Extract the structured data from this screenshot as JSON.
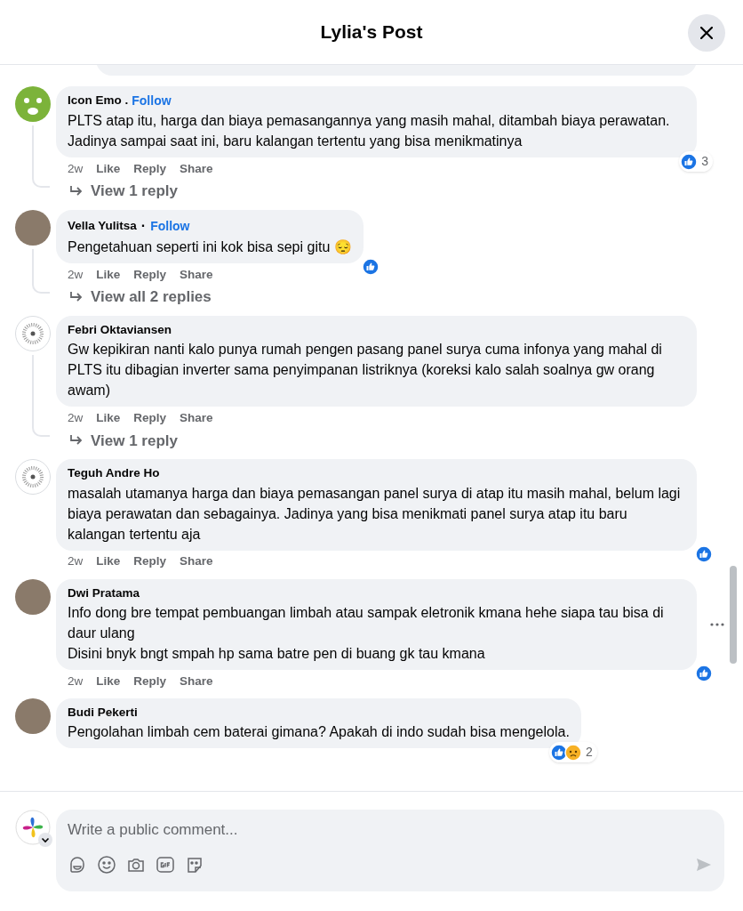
{
  "header": {
    "title": "Lylia's Post"
  },
  "comments": [
    {
      "name": "Icon Emo .",
      "follow": "Follow",
      "avatar": {
        "kind": "face"
      },
      "text": "PLTS atap itu, harga dan biaya pemasangannya yang masih mahal, ditambah biaya perawatan. Jadinya sampai saat ini, baru kalangan tertentu yang bisa menikmatinya",
      "time": "2w",
      "actions": [
        "Like",
        "Reply",
        "Share"
      ],
      "reactions": [
        {
          "kind": "like"
        }
      ],
      "reaction_count": "3",
      "replies": "View 1 reply"
    },
    {
      "name": "Vella Yulitsa",
      "separator": "·",
      "follow": "Follow",
      "avatar": {
        "kind": "photo"
      },
      "text": "Pengetahuan seperti ini kok bisa sepi gitu 😔",
      "time": "2w",
      "actions": [
        "Like",
        "Reply",
        "Share"
      ],
      "reactions": [
        {
          "kind": "like"
        }
      ],
      "replies": "View all 2 replies"
    },
    {
      "name": "Febri Oktaviansen",
      "avatar": {
        "kind": "pattern"
      },
      "text": "Gw kepikiran nanti kalo punya rumah pengen pasang panel surya cuma infonya yang mahal di PLTS itu dibagian inverter sama penyimpanan listriknya (koreksi kalo salah soalnya gw orang awam)",
      "time": "2w",
      "actions": [
        "Like",
        "Reply",
        "Share"
      ],
      "replies": "View 1 reply"
    },
    {
      "name": "Teguh Andre Ho",
      "avatar": {
        "kind": "pattern"
      },
      "text": "masalah utamanya harga dan biaya pemasangan panel surya di atap itu masih mahal, belum lagi biaya perawatan dan sebagainya. Jadinya yang bisa menikmati panel surya atap itu baru kalangan tertentu aja",
      "time": "2w",
      "actions": [
        "Like",
        "Reply",
        "Share"
      ],
      "reactions": [
        {
          "kind": "like"
        }
      ]
    },
    {
      "name": "Dwi Pratama",
      "avatar": {
        "kind": "photo"
      },
      "text": "Info dong bre tempat pembuangan limbah atau sampak eletronik kmana hehe siapa tau bisa di daur ulang\nDisini bnyk bngt smpah hp sama batre pen di buang gk tau kmana",
      "time": "2w",
      "actions": [
        "Like",
        "Reply",
        "Share"
      ],
      "reactions": [
        {
          "kind": "like"
        }
      ],
      "more_menu": true
    },
    {
      "name": "Budi Pekerti",
      "avatar": {
        "kind": "photo"
      },
      "text": "Pengolahan limbah cem baterai gimana? Apakah di indo sudah bisa mengelola.",
      "reactions": [
        {
          "kind": "like"
        },
        {
          "kind": "sad"
        }
      ],
      "reaction_count": "2"
    }
  ],
  "composer": {
    "placeholder": "Write a public comment..."
  }
}
